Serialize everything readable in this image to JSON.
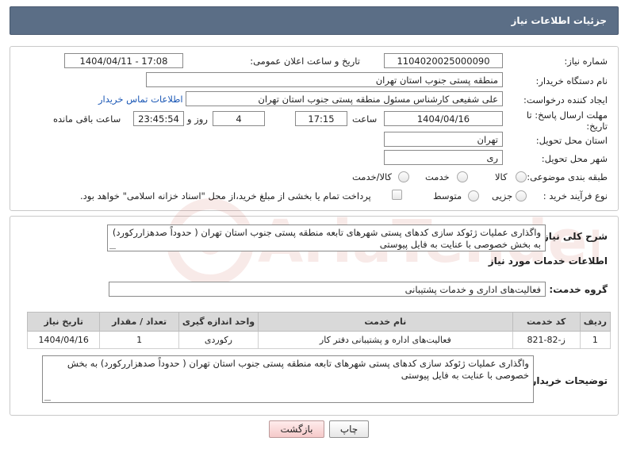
{
  "header": {
    "title": "جزئیات اطلاعات نیاز"
  },
  "form": {
    "need_number_label": "شماره نیاز:",
    "need_number": "1104020025000090",
    "announce_label": "تاریخ و ساعت اعلان عمومی:",
    "announce_value": "1404/04/11 - 17:08",
    "buyer_org_label": "نام دستگاه خریدار:",
    "buyer_org": "منطقه پستی جنوب استان تهران",
    "creator_label": "ایجاد کننده درخواست:",
    "creator": "علی شفیعی کارشناس مسئول منطقه پستی جنوب استان تهران",
    "contact_link": "اطلاعات تماس خریدار",
    "deadline_label_1": "مهلت ارسال پاسخ: تا",
    "deadline_label_2": "تاریخ:",
    "deadline_date": "1404/04/16",
    "time_label": "ساعت",
    "deadline_time": "17:15",
    "days_value": "4",
    "days_label": "روز و",
    "remaining_time": "23:45:54",
    "remaining_label": "ساعت باقی مانده",
    "province_label": "استان محل تحویل:",
    "province": "تهران",
    "city_label": "شهر محل تحویل:",
    "city": "ری",
    "category_label": "طبقه بندی موضوعی:",
    "category_options": [
      "کالا",
      "خدمت",
      "کالا/خدمت"
    ],
    "process_label": "نوع فرآیند خرید :",
    "process_options": [
      "جزیی",
      "متوسط"
    ],
    "payment_note": "پرداخت تمام یا بخشی از مبلغ خرید،از محل \"اسناد خزانه اسلامی\" خواهد بود."
  },
  "description": {
    "label": "شرح کلی نیاز:",
    "text": "واگذاری عملیات ژئوکد سازی کدهای پستی شهرهای تابعه منطقه پستی جنوب استان تهران ( حدوداً صدهزاررکورد) به بخش خصوصی با عنایت به فایل پیوستی"
  },
  "services": {
    "section_title": "اطلاعات خدمات مورد نیاز",
    "group_label": "گروه خدمت:",
    "group_value": "فعالیت‌های اداری و خدمات پشتیبانی",
    "columns": [
      "ردیف",
      "کد خدمت",
      "نام خدمت",
      "واحد اندازه گیری",
      "تعداد / مقدار",
      "تاریخ نیاز"
    ],
    "rows": [
      [
        "1",
        "ز-82-821",
        "فعالیت‌های اداره و پشتیبانی دفتر کار",
        "رکوردی",
        "1",
        "1404/04/16"
      ]
    ]
  },
  "buyer_notes": {
    "label": "توضیحات خریدار:",
    "text": "واگذاری عملیات ژئوکد سازی کدهای پستی شهرهای تابعه منطقه پستی جنوب استان تهران ( حدوداً صدهزاررکورد) به بخش خصوصی با عنایت به فایل پیوستی"
  },
  "buttons": {
    "print": "چاپ",
    "back": "بازگشت"
  },
  "watermark_text": "AriaTender.neT",
  "colors": {
    "header_bg": "#5b6e86",
    "link": "#1a57b5",
    "watermark": "#c0392b"
  }
}
